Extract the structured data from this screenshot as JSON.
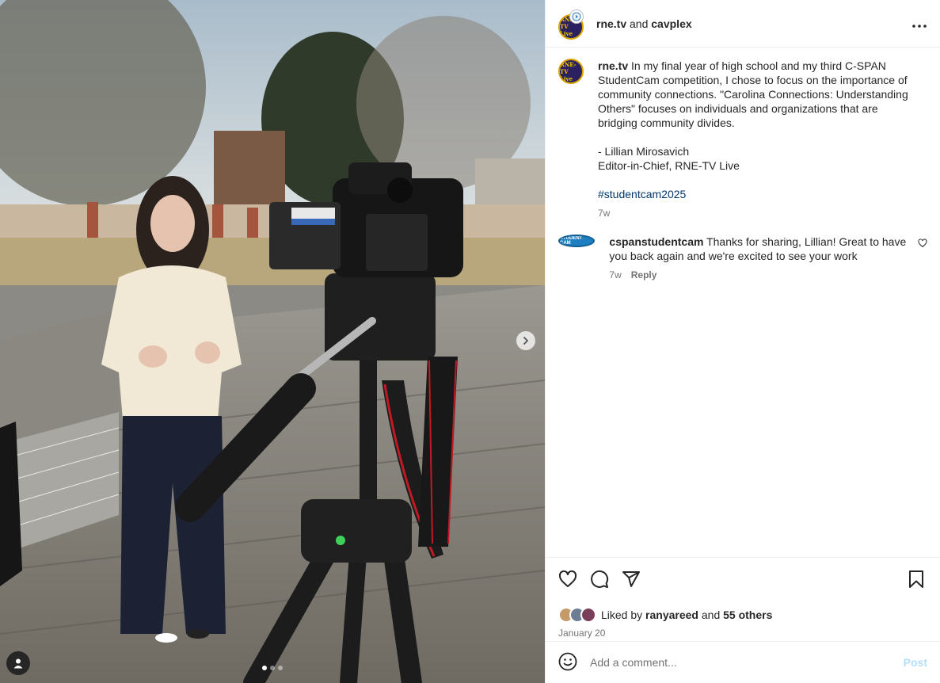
{
  "post": {
    "carousel": {
      "slide_index": 1,
      "slide_count": 3
    }
  },
  "header": {
    "author_primary": "rne.tv",
    "and_word": "and",
    "author_collab": "cavplex",
    "avatar_text": "RNE-TV Live"
  },
  "caption": {
    "username": "rne.tv",
    "paragraph": "In my final year of high school and my third C-SPAN StudentCam competition, I chose to focus on the importance of community connections. \"Carolina Connections: Understanding Others\" focuses on individuals and organizations that are bridging community divides.",
    "signature_name": "- Lillian Mirosavich",
    "signature_title": "Editor-in-Chief, RNE-TV Live",
    "hashtag": "#studentcam2025",
    "age": "7w"
  },
  "comments": [
    {
      "username": "cspanstudentcam",
      "avatar_text": "STUDENT CAM",
      "text": "Thanks for sharing, Lillian! Great to have you back again and we're excited to see your work",
      "age": "7w",
      "reply_label": "Reply"
    }
  ],
  "likes": {
    "prefix": "Liked by",
    "first_liker": "ranyareed",
    "and_word": "and",
    "others": "55 others"
  },
  "date": "January 20",
  "composer": {
    "placeholder": "Add a comment...",
    "post_label": "Post"
  },
  "icons": [
    "more-icon",
    "heart-icon",
    "comment-icon",
    "share-icon",
    "bookmark-icon",
    "emoji-icon",
    "chevron-right-icon",
    "user-tag-icon"
  ],
  "colors": {
    "hashtag": "#00376b",
    "muted": "#737373",
    "post_disabled": "#b2dffc",
    "avatar_bg": "#2b2160",
    "avatar_accent": "#f2c300"
  }
}
